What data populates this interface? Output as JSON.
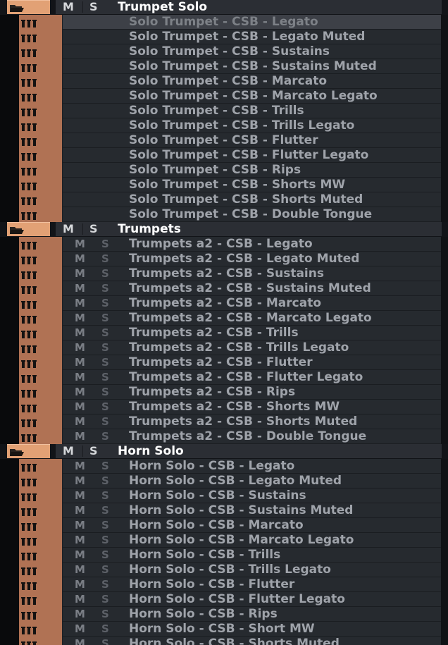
{
  "icons": {
    "folder": "folder-open-icon",
    "midi_track": "midi-track-icon"
  },
  "colors": {
    "folder_color": "#e2a175",
    "track_color": "#b07254",
    "selected_row": "#3d4047",
    "row": "#262a2f"
  },
  "folders": [
    {
      "name": "Trumpet Solo",
      "mute_label": "M",
      "solo_label": "S",
      "tracks": [
        {
          "name": "Solo Trumpet - CSB - Legato",
          "selected": true,
          "show_ms": false
        },
        {
          "name": "Solo Trumpet - CSB - Legato Muted",
          "show_ms": false
        },
        {
          "name": "Solo Trumpet - CSB - Sustains",
          "show_ms": false
        },
        {
          "name": "Solo Trumpet - CSB - Sustains Muted",
          "show_ms": false
        },
        {
          "name": "Solo Trumpet - CSB - Marcato",
          "show_ms": false
        },
        {
          "name": "Solo Trumpet - CSB - Marcato Legato",
          "show_ms": false
        },
        {
          "name": "Solo Trumpet - CSB - Trills",
          "show_ms": false
        },
        {
          "name": "Solo Trumpet - CSB - Trills Legato",
          "show_ms": false
        },
        {
          "name": "Solo Trumpet - CSB - Flutter",
          "show_ms": false
        },
        {
          "name": "Solo Trumpet - CSB - Flutter Legato",
          "show_ms": false
        },
        {
          "name": "Solo Trumpet - CSB - Rips",
          "show_ms": false
        },
        {
          "name": "Solo Trumpet - CSB - Shorts MW",
          "show_ms": false
        },
        {
          "name": "Solo Trumpet - CSB - Shorts Muted",
          "show_ms": false
        },
        {
          "name": "Solo Trumpet - CSB - Double Tongue",
          "show_ms": false
        }
      ]
    },
    {
      "name": "Trumpets",
      "mute_label": "M",
      "solo_label": "S",
      "tracks": [
        {
          "name": "Trumpets a2 - CSB - Legato",
          "mute": "M",
          "solo": "S",
          "show_ms": true
        },
        {
          "name": "Trumpets a2 - CSB - Legato Muted",
          "mute": "M",
          "solo": "S",
          "show_ms": true
        },
        {
          "name": "Trumpets a2 - CSB - Sustains",
          "mute": "M",
          "solo": "S",
          "show_ms": true
        },
        {
          "name": "Trumpets a2 - CSB - Sustains Muted",
          "mute": "M",
          "solo": "S",
          "show_ms": true
        },
        {
          "name": "Trumpets a2 - CSB - Marcato",
          "mute": "M",
          "solo": "S",
          "show_ms": true
        },
        {
          "name": "Trumpets a2 - CSB - Marcato Legato",
          "mute": "M",
          "solo": "S",
          "show_ms": true
        },
        {
          "name": "Trumpets a2 - CSB - Trills",
          "mute": "M",
          "solo": "S",
          "show_ms": true
        },
        {
          "name": "Trumpets a2 - CSB - Trills Legato",
          "mute": "M",
          "solo": "S",
          "show_ms": true
        },
        {
          "name": "Trumpets a2 - CSB - Flutter",
          "mute": "M",
          "solo": "S",
          "show_ms": true
        },
        {
          "name": "Trumpets a2 - CSB - Flutter Legato",
          "mute": "M",
          "solo": "S",
          "show_ms": true
        },
        {
          "name": "Trumpets a2 - CSB - Rips",
          "mute": "M",
          "solo": "S",
          "show_ms": true
        },
        {
          "name": "Trumpets a2 - CSB - Shorts MW",
          "mute": "M",
          "solo": "S",
          "show_ms": true
        },
        {
          "name": "Trumpets a2 - CSB - Shorts Muted",
          "mute": "M",
          "solo": "S",
          "show_ms": true
        },
        {
          "name": "Trumpets a2 - CSB - Double Tongue",
          "mute": "M",
          "solo": "S",
          "show_ms": true
        }
      ]
    },
    {
      "name": "Horn Solo",
      "mute_label": "M",
      "solo_label": "S",
      "tracks": [
        {
          "name": "Horn Solo - CSB - Legato",
          "mute": "M",
          "solo": "S",
          "show_ms": true
        },
        {
          "name": "Horn Solo - CSB - Legato Muted",
          "mute": "M",
          "solo": "S",
          "show_ms": true
        },
        {
          "name": "Horn Solo - CSB - Sustains",
          "mute": "M",
          "solo": "S",
          "show_ms": true
        },
        {
          "name": "Horn Solo - CSB - Sustains Muted",
          "mute": "M",
          "solo": "S",
          "show_ms": true
        },
        {
          "name": "Horn Solo - CSB - Marcato",
          "mute": "M",
          "solo": "S",
          "show_ms": true
        },
        {
          "name": "Horn Solo - CSB - Marcato Legato",
          "mute": "M",
          "solo": "S",
          "show_ms": true
        },
        {
          "name": "Horn Solo - CSB - Trills",
          "mute": "M",
          "solo": "S",
          "show_ms": true
        },
        {
          "name": "Horn Solo - CSB - Trills Legato",
          "mute": "M",
          "solo": "S",
          "show_ms": true
        },
        {
          "name": "Horn Solo - CSB - Flutter",
          "mute": "M",
          "solo": "S",
          "show_ms": true
        },
        {
          "name": "Horn Solo - CSB - Flutter Legato",
          "mute": "M",
          "solo": "S",
          "show_ms": true
        },
        {
          "name": "Horn Solo - CSB - Rips",
          "mute": "M",
          "solo": "S",
          "show_ms": true
        },
        {
          "name": "Horn Solo - CSB - Short MW",
          "mute": "M",
          "solo": "S",
          "show_ms": true
        },
        {
          "name": "Horn Solo - CSB - Shorts Muted",
          "mute": "M",
          "solo": "S",
          "show_ms": true
        }
      ]
    }
  ]
}
